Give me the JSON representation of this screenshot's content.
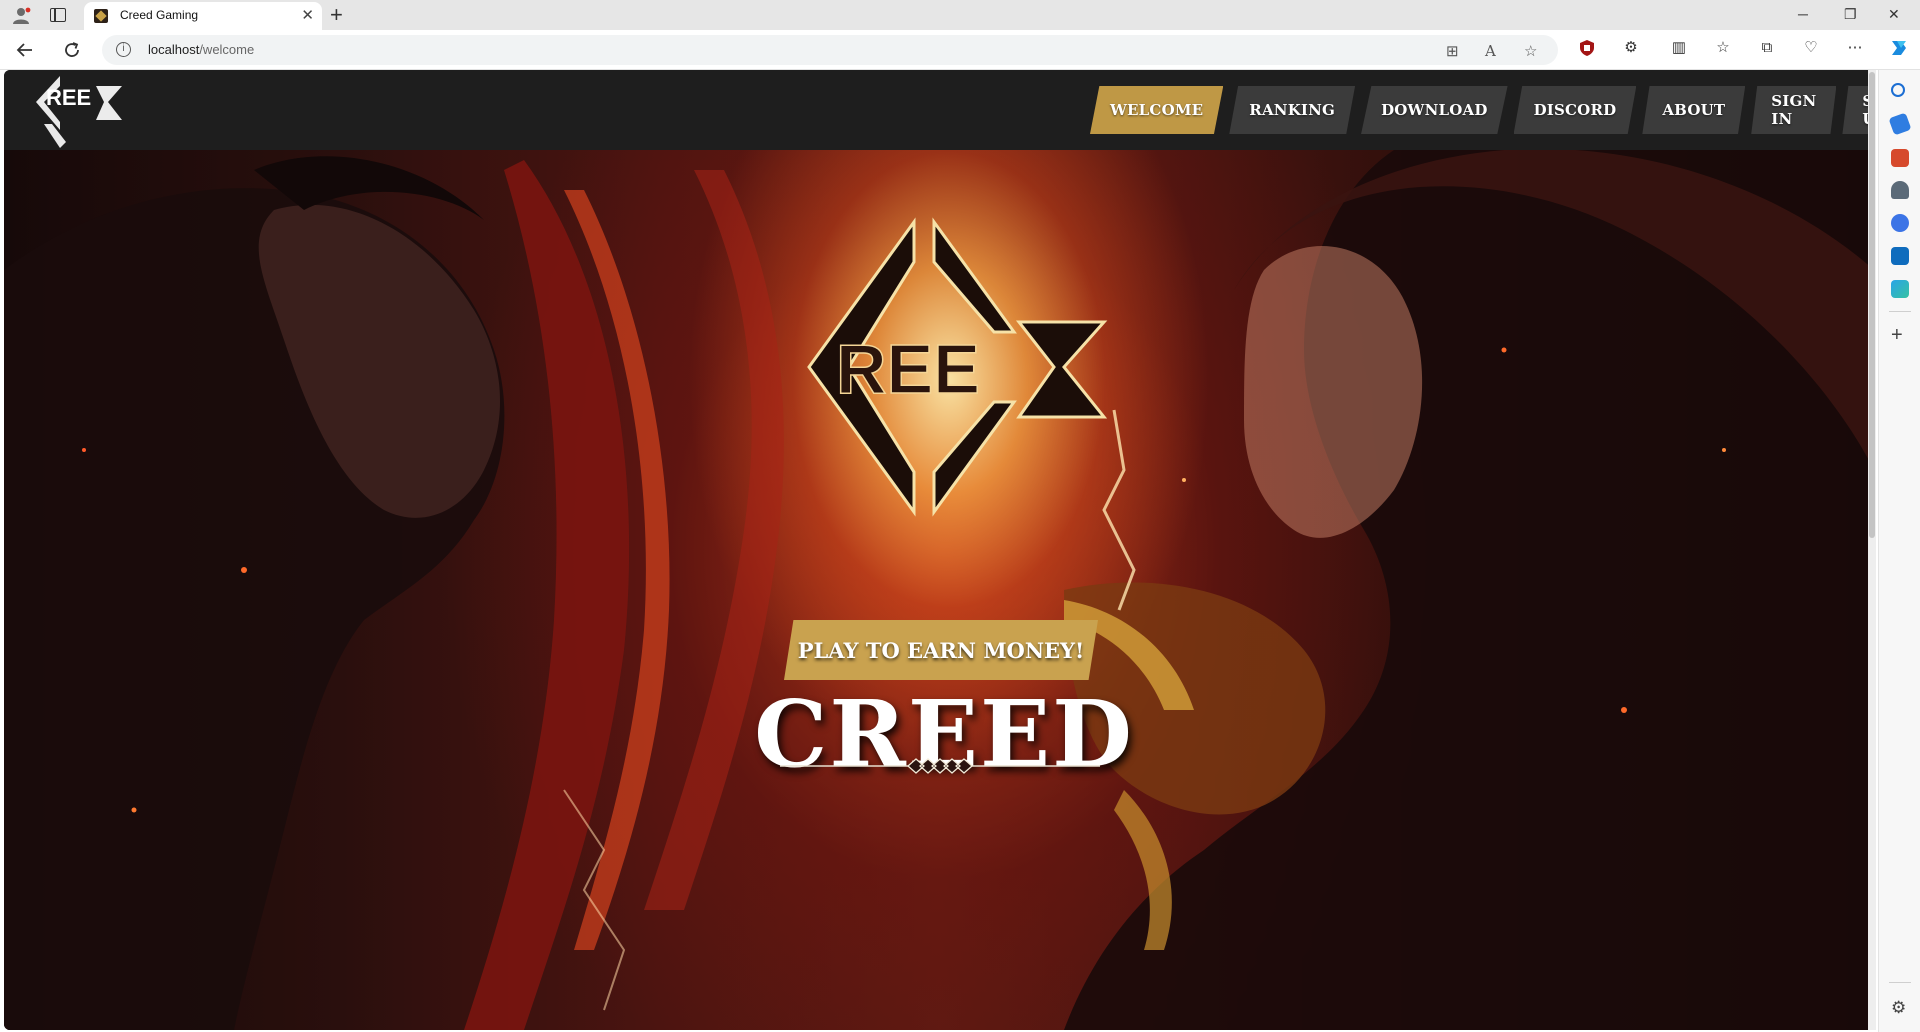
{
  "browser": {
    "tab_title": "Creed Gaming",
    "tab_close": "✕",
    "new_tab": "+",
    "url_host": "localhost",
    "url_path": "/welcome",
    "window_controls": {
      "minimize": "─",
      "restore": "❐",
      "close": "✕"
    }
  },
  "site": {
    "logo_text": "REE",
    "nav": [
      {
        "label": "WELCOME",
        "active": true
      },
      {
        "label": "RANKING"
      },
      {
        "label": "DOWNLOAD"
      },
      {
        "label": "DISCORD"
      },
      {
        "label": "ABOUT"
      },
      {
        "label": "SIGN IN"
      },
      {
        "label": "SIGN UP"
      }
    ],
    "hero": {
      "logo_text": "REE",
      "cta_label": "PLAY TO EARN MONEY!",
      "title": "CREED"
    }
  },
  "colors": {
    "accent_gold": "#bf9845",
    "nav_bg": "#3b3b3b",
    "header_bg": "#1e1e1e"
  },
  "icons": {
    "toolbar": [
      "back-icon",
      "refresh-icon",
      "info-icon",
      "app-install-icon",
      "read-aloud-icon",
      "favorite-star-icon",
      "shield-extension-icon",
      "extensions-icon",
      "split-screen-icon",
      "favorites-icon",
      "collections-icon",
      "performance-icon",
      "more-icon",
      "copilot-icon"
    ],
    "sidebar": [
      "search-icon",
      "shopping-icon",
      "tools-icon",
      "games-icon",
      "office-icon",
      "outlook-icon",
      "telegram-icon",
      "add-icon",
      "settings-icon"
    ]
  }
}
